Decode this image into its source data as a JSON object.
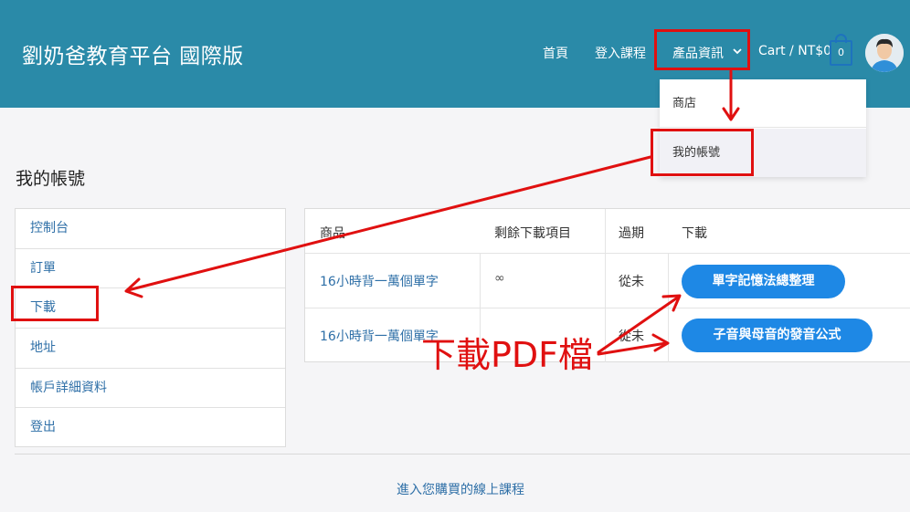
{
  "header": {
    "site_title": "劉奶爸教育平台 國際版",
    "nav": {
      "home": "首頁",
      "login": "登入課程",
      "products": "產品資訊",
      "cart": "Cart / NT$0",
      "cart_count": "0"
    }
  },
  "dropdown": {
    "shop": "商店",
    "my_account": "我的帳號"
  },
  "page": {
    "title": "我的帳號"
  },
  "sidebar": {
    "items": [
      "控制台",
      "訂單",
      "下載",
      "地址",
      "帳戶詳細資料",
      "登出"
    ]
  },
  "downloads_table": {
    "headers": {
      "product": "商品",
      "remaining": "剩餘下載項目",
      "expires": "過期",
      "download": "下載"
    },
    "rows": [
      {
        "product": "16小時背一萬個單字",
        "remaining": "∞",
        "expires": "從未",
        "download": "單字記憶法總整理"
      },
      {
        "product": "16小時背一萬個單字",
        "remaining": "",
        "expires": "從未",
        "download": "子音與母音的發音公式"
      }
    ]
  },
  "footer": {
    "link": "進入您購買的線上課程"
  },
  "annotation": {
    "label": "下載PDF檔",
    "color": "#e01010"
  },
  "colors": {
    "header_bg": "#2a8aa8",
    "link": "#2e6fa7",
    "button": "#1e88e5",
    "cart_accent": "#1e73be"
  }
}
